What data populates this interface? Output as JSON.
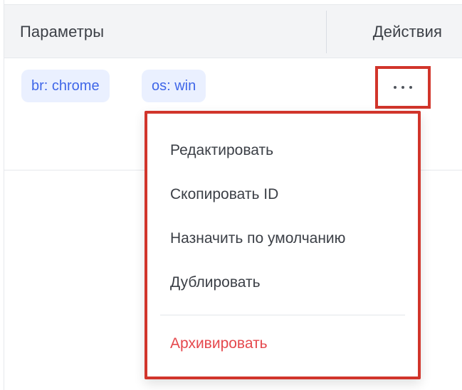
{
  "table": {
    "headers": {
      "params_label": "Параметры",
      "actions_label": "Действия"
    },
    "row": {
      "tags": [
        "br: chrome",
        "os: win"
      ]
    }
  },
  "actions_menu": {
    "items": [
      "Редактировать",
      "Скопировать ID",
      "Назначить по умолчанию",
      "Дублировать"
    ],
    "danger_item": "Архивировать"
  },
  "colors": {
    "highlight_border": "#d1352b",
    "tag_background": "#eaf0ff",
    "tag_text": "#3f66e8",
    "danger_text": "#e5484d",
    "header_background": "#f3f4f6"
  },
  "icons": {
    "row_actions": "more-horizontal-icon"
  }
}
